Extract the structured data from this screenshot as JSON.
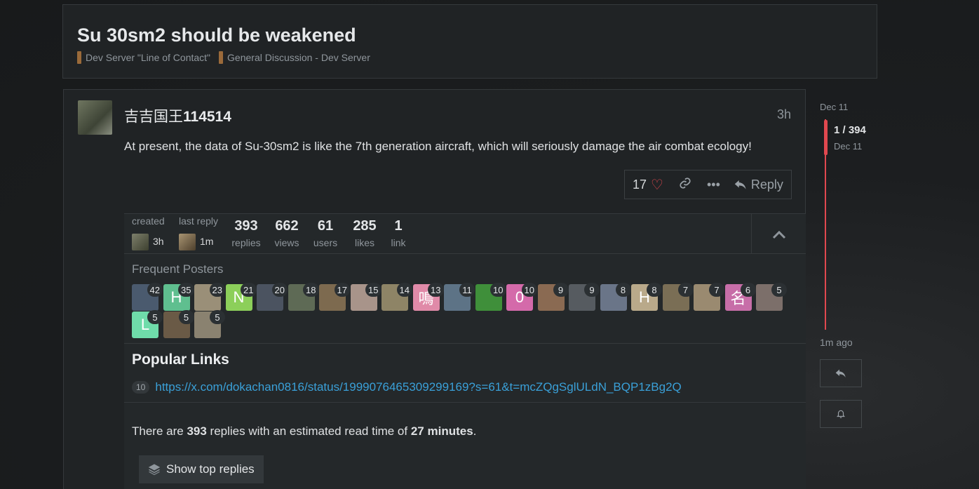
{
  "topic": {
    "title": "Su 30sm2 should be weakened",
    "categories": [
      "Dev Server \"Line of Contact\"",
      "General Discussion - Dev Server"
    ]
  },
  "post": {
    "username_cjk": "吉吉国王",
    "username_num": "114514",
    "time": "3h",
    "body": "At present, the data of Su-30sm2 is like the 7th generation aircraft, which will seriously damage the air combat ecology!",
    "likes": "17",
    "reply_label": "Reply"
  },
  "summary": {
    "created_label": "created",
    "created_time": "3h",
    "last_reply_label": "last reply",
    "last_reply_time": "1m",
    "stats": [
      {
        "n": "393",
        "l": "replies"
      },
      {
        "n": "662",
        "l": "views"
      },
      {
        "n": "61",
        "l": "users"
      },
      {
        "n": "285",
        "l": "likes"
      },
      {
        "n": "1",
        "l": "link"
      }
    ],
    "frequent_title": "Frequent Posters",
    "posters": [
      {
        "count": "42",
        "color": "#4a5a6e",
        "letter": ""
      },
      {
        "count": "35",
        "color": "#5fbf8f",
        "letter": "H"
      },
      {
        "count": "23",
        "color": "#9a8f78",
        "letter": ""
      },
      {
        "count": "21",
        "color": "#8ccf5a",
        "letter": "N"
      },
      {
        "count": "20",
        "color": "#4b5360",
        "letter": ""
      },
      {
        "count": "18",
        "color": "#5e6a55",
        "letter": ""
      },
      {
        "count": "17",
        "color": "#7d6a4f",
        "letter": ""
      },
      {
        "count": "15",
        "color": "#a8948a",
        "letter": ""
      },
      {
        "count": "14",
        "color": "#8e8466",
        "letter": ""
      },
      {
        "count": "13",
        "color": "#e08aa8",
        "letter": "鳴"
      },
      {
        "count": "11",
        "color": "#5d7386",
        "letter": ""
      },
      {
        "count": "10",
        "color": "#3f8f3a",
        "letter": ""
      },
      {
        "count": "10",
        "color": "#d46aaa",
        "letter": "0"
      },
      {
        "count": "9",
        "color": "#8a6a52",
        "letter": ""
      },
      {
        "count": "9",
        "color": "#565b60",
        "letter": ""
      },
      {
        "count": "8",
        "color": "#6a7588",
        "letter": ""
      },
      {
        "count": "8",
        "color": "#b9a98a",
        "letter": "H"
      },
      {
        "count": "7",
        "color": "#7a6e55",
        "letter": ""
      },
      {
        "count": "7",
        "color": "#9a8a70",
        "letter": ""
      },
      {
        "count": "6",
        "color": "#c76ea8",
        "letter": "名"
      },
      {
        "count": "5",
        "color": "#7c6f6a",
        "letter": ""
      },
      {
        "count": "5",
        "color": "#6fdcaa",
        "letter": "L"
      },
      {
        "count": "5",
        "color": "#6a5a46",
        "letter": ""
      },
      {
        "count": "5",
        "color": "#8a8270",
        "letter": ""
      }
    ],
    "popular_links_title": "Popular Links",
    "link_clicks": "10",
    "link_url": "https://x.com/dokachan0816/status/1999076465309299169?s=61&t=mcZQgSglULdN_BQP1zBg2Q",
    "est_prefix": "There are ",
    "est_replies": "393",
    "est_mid": " replies with an estimated read time of ",
    "est_time": "27 minutes",
    "est_suffix": ".",
    "show_top_label": "Show top replies"
  },
  "timeline": {
    "top_date": "Dec 11",
    "position": "1 / 394",
    "position_date": "Dec 11",
    "bottom_label": "1m ago"
  },
  "colors": {
    "accent_red": "#e0484f",
    "link_blue": "#3aa0d8",
    "category_brown": "#9a6a3a"
  }
}
